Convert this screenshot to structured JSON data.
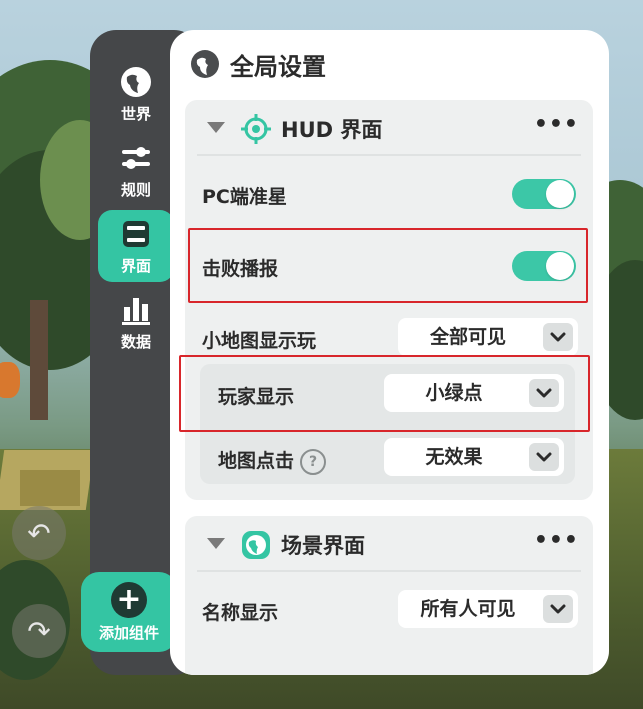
{
  "side_nav": {
    "items": [
      {
        "label": "世界",
        "icon": "globe-icon"
      },
      {
        "label": "规则",
        "icon": "sliders-icon"
      },
      {
        "label": "界面",
        "icon": "screen-icon",
        "active": true
      },
      {
        "label": "数据",
        "icon": "bar-chart-icon"
      }
    ],
    "add_component_label": "添加组件"
  },
  "panel": {
    "title": "全局设置",
    "hud_section": {
      "title": "HUD 界面",
      "more": "•••",
      "pc_crosshair": {
        "label": "PC端准星",
        "enabled": true
      },
      "defeat_broadcast": {
        "label": "击败播报",
        "enabled": true
      },
      "minimap_display": {
        "label": "小地图显示玩",
        "value": "全部可见"
      },
      "player_display": {
        "label": "玩家显示",
        "value": "小绿点"
      },
      "map_click": {
        "label": "地图点击",
        "help": "?",
        "value": "无效果"
      }
    },
    "scene_section": {
      "title": "场景界面",
      "more": "•••",
      "name_display": {
        "label": "名称显示",
        "value": "所有人可见"
      }
    }
  },
  "colors": {
    "accent": "#34c5a3",
    "highlight_border": "#d8262b",
    "rail_bg": "#454749"
  }
}
